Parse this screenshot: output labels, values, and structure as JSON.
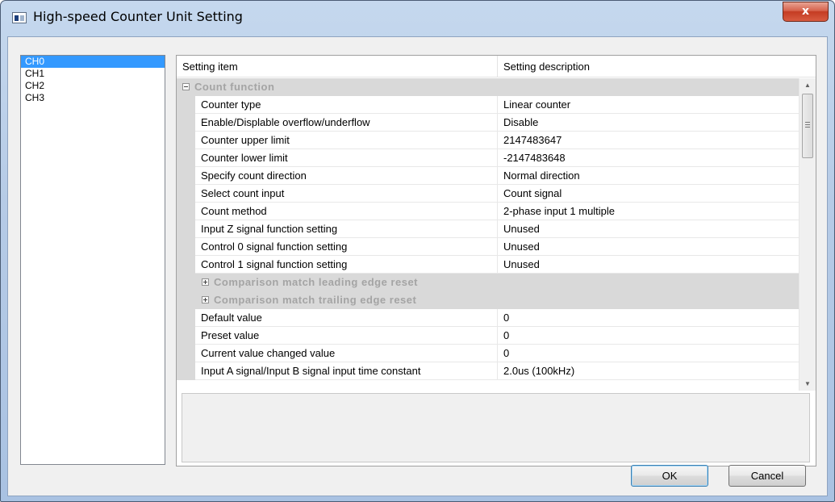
{
  "window": {
    "title": "High-speed Counter Unit Setting",
    "close_label": "x"
  },
  "channels": [
    {
      "label": "CH0",
      "selected": true
    },
    {
      "label": "CH1",
      "selected": false
    },
    {
      "label": "CH2",
      "selected": false
    },
    {
      "label": "CH3",
      "selected": false
    }
  ],
  "grid": {
    "col_item": "Setting item",
    "col_desc": "Setting description",
    "category": "Count function",
    "rows_a": [
      {
        "name": "Counter type",
        "value": "Linear counter"
      },
      {
        "name": "Enable/Displable overflow/underflow",
        "value": "Disable"
      },
      {
        "name": "Counter upper limit",
        "value": "2147483647"
      },
      {
        "name": "Counter lower limit",
        "value": "-2147483648"
      },
      {
        "name": "Specify count direction",
        "value": "Normal direction"
      },
      {
        "name": "Select count input",
        "value": "Count signal"
      },
      {
        "name": "Count method",
        "value": "2-phase input 1 multiple"
      },
      {
        "name": "Input Z signal function setting",
        "value": "Unused"
      },
      {
        "name": "Control 0 signal function setting",
        "value": "Unused"
      },
      {
        "name": "Control 1 signal function setting",
        "value": "Unused"
      }
    ],
    "subcategories": [
      "Comparison match leading edge reset",
      "Comparison match trailing edge reset"
    ],
    "rows_b": [
      {
        "name": "Default value",
        "value": "0"
      },
      {
        "name": "Preset value",
        "value": "0"
      },
      {
        "name": "Current value changed value",
        "value": "0"
      },
      {
        "name": "Input A signal/Input B signal input time constant",
        "value": "2.0us (100kHz)"
      }
    ]
  },
  "buttons": {
    "ok": "OK",
    "cancel": "Cancel"
  }
}
